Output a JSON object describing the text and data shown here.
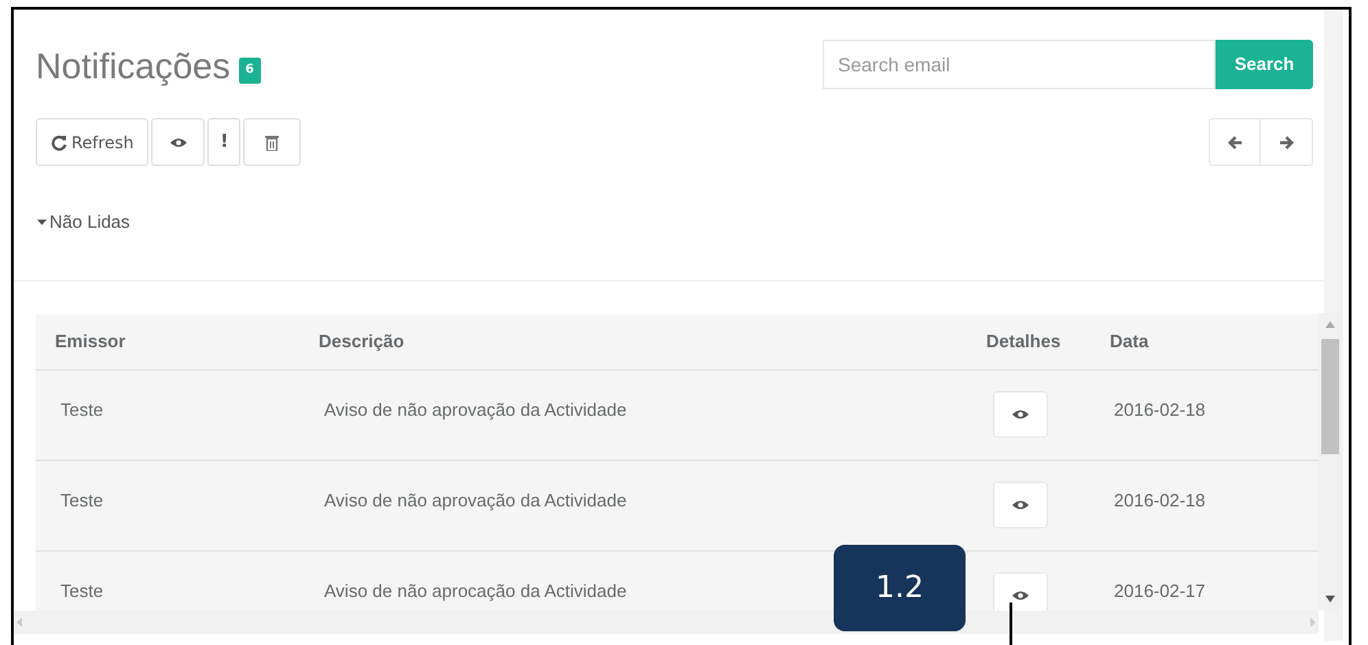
{
  "header": {
    "title": "Notificações",
    "badge": "6"
  },
  "search": {
    "placeholder": "Search email",
    "button": "Search"
  },
  "toolbar": {
    "refresh": "Refresh",
    "mark_important": "!"
  },
  "filter": {
    "label": "Não Lidas",
    "expanded": true
  },
  "table": {
    "columns": [
      "Emissor",
      "Descrição",
      "Detalhes",
      "Data"
    ],
    "rows": [
      {
        "emissor": "Teste",
        "descricao": "Aviso de não aprovação da Actividade",
        "data": "2016-02-18"
      },
      {
        "emissor": "Teste",
        "descricao": "Aviso de não aprovação da Actividade",
        "data": "2016-02-18"
      },
      {
        "emissor": "Teste",
        "descricao": "Aviso de não aprocação da Actividade",
        "data": "2016-02-17"
      }
    ]
  },
  "callout": {
    "label": "1.2"
  }
}
